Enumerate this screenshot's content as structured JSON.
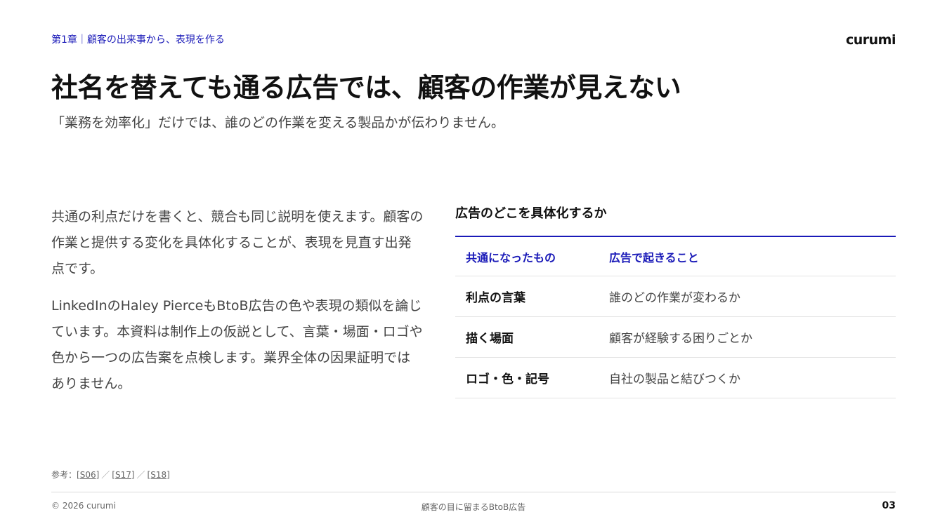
{
  "header": {
    "chapter": "第1章｜顧客の出来事から、表現を作る",
    "brand": "curumi"
  },
  "title": "社名を替えても通る広告では、顧客の作業が見えない",
  "subtitle": "「業務を効率化」だけでは、誰のどの作業を変える製品かが伝わりません。",
  "body": {
    "paragraph1": "共通の利点だけを書くと、競合も同じ説明を使えます。顧客の作業と提供する変化を具体化することが、表現を見直す出発点です。",
    "paragraph2": "LinkedInのHaley PierceもBtoB広告の色や表現の類似を論じています。本資料は制作上の仮説として、言葉・場面・ロゴや色から一つの広告案を点検します。業界全体の因果証明ではありません。"
  },
  "table": {
    "heading": "広告のどこを具体化するか",
    "columns": [
      "共通になったもの",
      "広告で起きること"
    ],
    "rows": [
      [
        "利点の言葉",
        "誰のどの作業が変わるか"
      ],
      [
        "描く場面",
        "顧客が経験する困りごとか"
      ],
      [
        "ロゴ・色・記号",
        "自社の製品と結びつくか"
      ]
    ]
  },
  "references": {
    "label": "参考：",
    "items": [
      "[S06]",
      "[S17]",
      "[S18]"
    ],
    "separator": "／"
  },
  "footer": {
    "copyright": "© 2026 curumi",
    "center": "顧客の目に留まるBtoB広告",
    "page": "03"
  },
  "colors": {
    "accent": "#1a1ab8",
    "text": "#111111",
    "muted": "#444444"
  }
}
